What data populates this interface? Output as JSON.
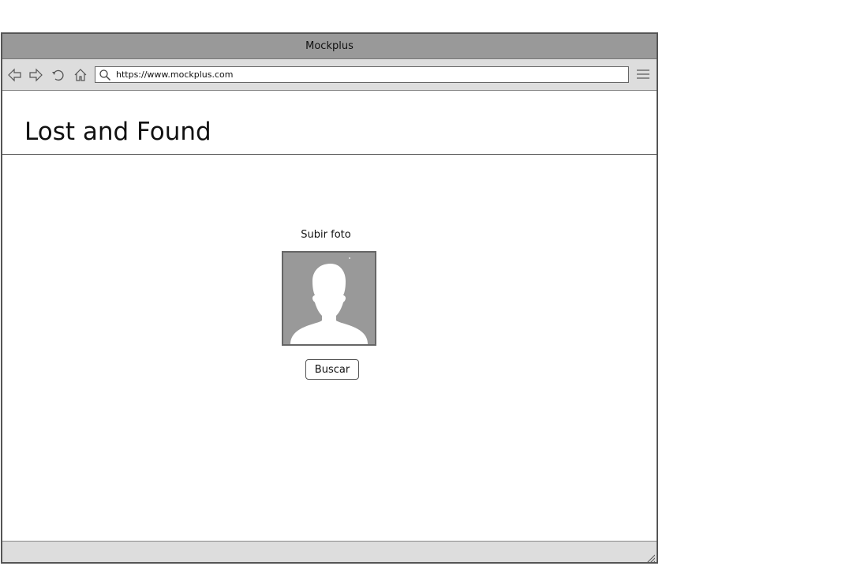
{
  "window": {
    "title": "Mockplus"
  },
  "toolbar": {
    "url": "https://www.mockplus.com",
    "icons": [
      "back-icon",
      "forward-icon",
      "refresh-icon",
      "home-icon",
      "search-icon",
      "menu-icon"
    ]
  },
  "page": {
    "title": "Lost and Found",
    "upload_label": "Subir foto",
    "photo_icon": "avatar-placeholder-icon",
    "search_button": "Buscar"
  },
  "colors": {
    "titlebar": "#999999",
    "toolbar": "#dddddd",
    "border": "#555555",
    "photo_bg": "#999999"
  }
}
